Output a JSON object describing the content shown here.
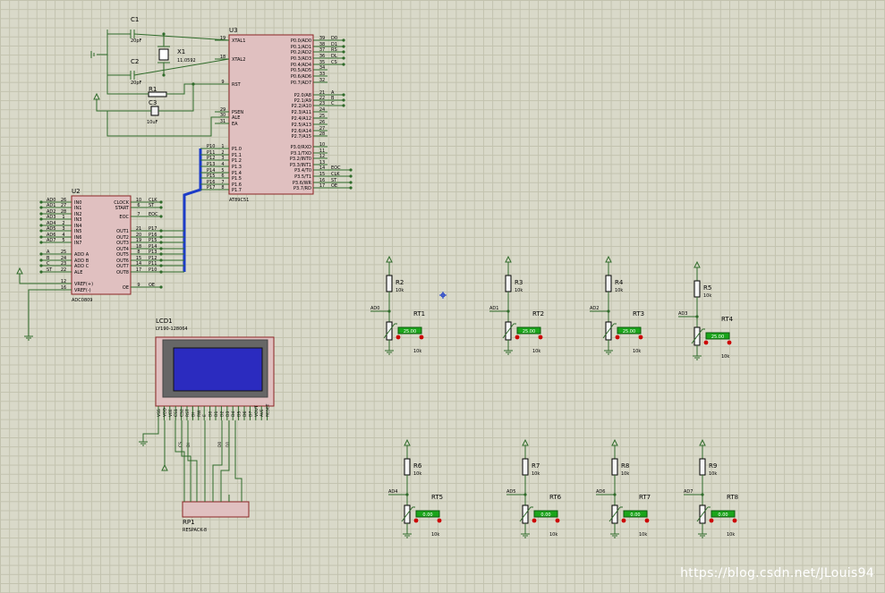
{
  "components": {
    "c1": {
      "ref": "C1",
      "value": "20pF"
    },
    "c2": {
      "ref": "C2",
      "value": "20pF"
    },
    "c3": {
      "ref": "C3",
      "value": "10uF"
    },
    "r1": {
      "ref": "R1"
    },
    "x1": {
      "ref": "X1",
      "value": "11.0592"
    },
    "u3": {
      "ref": "U3",
      "part": "AT89C51",
      "left_pins": [
        {
          "num": "19",
          "name": "XTAL1"
        },
        {
          "num": "18",
          "name": "XTAL2"
        },
        {
          "num": "9",
          "name": "RST"
        },
        {
          "num": "29",
          "name": "PSEN"
        },
        {
          "num": "30",
          "name": "ALE"
        },
        {
          "num": "31",
          "name": "EA"
        },
        {
          "num": "1",
          "name": "P1.0"
        },
        {
          "num": "2",
          "name": "P1.1"
        },
        {
          "num": "3",
          "name": "P1.2"
        },
        {
          "num": "4",
          "name": "P1.3"
        },
        {
          "num": "5",
          "name": "P1.4"
        },
        {
          "num": "6",
          "name": "P1.5"
        },
        {
          "num": "7",
          "name": "P1.6"
        },
        {
          "num": "8",
          "name": "P1.7"
        }
      ],
      "right_pins": [
        {
          "num": "39",
          "name": "P0.0/AD0"
        },
        {
          "num": "38",
          "name": "P0.1/AD1"
        },
        {
          "num": "37",
          "name": "P0.2/AD2"
        },
        {
          "num": "36",
          "name": "P0.3/AD3"
        },
        {
          "num": "35",
          "name": "P0.4/AD4"
        },
        {
          "num": "34",
          "name": "P0.5/AD5"
        },
        {
          "num": "33",
          "name": "P0.6/AD6"
        },
        {
          "num": "32",
          "name": "P0.7/AD7"
        },
        {
          "num": "21",
          "name": "P2.0/A8"
        },
        {
          "num": "22",
          "name": "P2.1/A9"
        },
        {
          "num": "23",
          "name": "P2.2/A10"
        },
        {
          "num": "24",
          "name": "P2.3/A11"
        },
        {
          "num": "25",
          "name": "P2.4/A12"
        },
        {
          "num": "26",
          "name": "P2.5/A13"
        },
        {
          "num": "27",
          "name": "P2.6/A14"
        },
        {
          "num": "28",
          "name": "P2.7/A15"
        },
        {
          "num": "10",
          "name": "P3.0/RXD"
        },
        {
          "num": "11",
          "name": "P3.1/TXD"
        },
        {
          "num": "12",
          "name": "P3.2/INT0"
        },
        {
          "num": "13",
          "name": "P3.3/INT1"
        },
        {
          "num": "14",
          "name": "P3.4/T0"
        },
        {
          "num": "15",
          "name": "P3.5/T1"
        },
        {
          "num": "16",
          "name": "P3.6/WR"
        },
        {
          "num": "17",
          "name": "P3.7/RD"
        }
      ],
      "p1_labels": [
        "P10",
        "P11",
        "P12",
        "P13",
        "P14",
        "P15",
        "P16",
        "P17"
      ],
      "p0_labels": [
        "D0",
        "D1",
        "RS",
        "DL",
        "CS"
      ],
      "p2_labels": [
        "A",
        "B",
        "C"
      ],
      "p3_labels": [
        "EOC",
        "CLK",
        "ST",
        "OE"
      ]
    },
    "u2": {
      "ref": "U2",
      "part": "ADC0809",
      "left_pins": [
        {
          "num": "26",
          "name": "IN0",
          "net": "AD0"
        },
        {
          "num": "27",
          "name": "IN1",
          "net": "AD1"
        },
        {
          "num": "28",
          "name": "IN2",
          "net": "AD2"
        },
        {
          "num": "1",
          "name": "IN3",
          "net": "AD3"
        },
        {
          "num": "2",
          "name": "IN4",
          "net": "AD4"
        },
        {
          "num": "3",
          "name": "IN5",
          "net": "AD5"
        },
        {
          "num": "4",
          "name": "IN6",
          "net": "AD6"
        },
        {
          "num": "5",
          "name": "IN7",
          "net": "AD7"
        },
        {
          "num": "25",
          "name": "ADD A",
          "net": "A"
        },
        {
          "num": "24",
          "name": "ADD B",
          "net": "B"
        },
        {
          "num": "23",
          "name": "ADD C",
          "net": "C"
        },
        {
          "num": "22",
          "name": "ALE",
          "net": "ST"
        },
        {
          "num": "12",
          "name": "VREF(+)",
          "net": ""
        },
        {
          "num": "16",
          "name": "VREF(-)",
          "net": ""
        }
      ],
      "right_pins": [
        {
          "num": "10",
          "name": "CLOCK",
          "net": "CLK"
        },
        {
          "num": "6",
          "name": "START",
          "net": "ST"
        },
        {
          "num": "7",
          "name": "EOC",
          "net": "EOC"
        },
        {
          "num": "21",
          "name": "OUT1",
          "net": "P17"
        },
        {
          "num": "20",
          "name": "OUT2",
          "net": "P16"
        },
        {
          "num": "19",
          "name": "OUT3",
          "net": "P15"
        },
        {
          "num": "18",
          "name": "OUT4",
          "net": "P14"
        },
        {
          "num": "8",
          "name": "OUT5",
          "net": "P13"
        },
        {
          "num": "15",
          "name": "OUT6",
          "net": "P12"
        },
        {
          "num": "14",
          "name": "OUT7",
          "net": "P11"
        },
        {
          "num": "17",
          "name": "OUT8",
          "net": "P10"
        },
        {
          "num": "9",
          "name": "OE",
          "net": "OE"
        }
      ]
    },
    "lcd": {
      "ref": "LCD1",
      "part": "LY190-128064",
      "pins": [
        "VSS",
        "VDD",
        "VEE",
        "CS1",
        "CS2",
        "RST",
        "DI",
        "RW",
        "E",
        "D0",
        "D1",
        "D2",
        "D3",
        "D4",
        "D5",
        "D6",
        "D7",
        "VOUT",
        "AVE",
        "RESET"
      ],
      "bottom_labels": [
        "CS",
        "DI",
        "D0",
        "D1"
      ]
    },
    "rp1": {
      "ref": "RP1",
      "part": "RESPACK-8"
    },
    "sensors": [
      {
        "res": "R2",
        "val": "10k",
        "ntc": "RT1",
        "ntc_val": "10k",
        "net": "AD0",
        "temp": "25.00"
      },
      {
        "res": "R3",
        "val": "10k",
        "ntc": "RT2",
        "ntc_val": "10k",
        "net": "AD1",
        "temp": "25.00"
      },
      {
        "res": "R4",
        "val": "10k",
        "ntc": "RT3",
        "ntc_val": "10k",
        "net": "AD2",
        "temp": "25.00"
      },
      {
        "res": "R5",
        "val": "10k",
        "ntc": "RT4",
        "ntc_val": "10k",
        "net": "AD3",
        "temp": "25.00"
      },
      {
        "res": "R6",
        "val": "10k",
        "ntc": "RT5",
        "ntc_val": "10k",
        "net": "AD4",
        "temp": "0.00"
      },
      {
        "res": "R7",
        "val": "10k",
        "ntc": "RT6",
        "ntc_val": "10k",
        "net": "AD5",
        "temp": "0.00"
      },
      {
        "res": "R8",
        "val": "10k",
        "ntc": "RT7",
        "ntc_val": "10k",
        "net": "AD6",
        "temp": "0.00"
      },
      {
        "res": "R9",
        "val": "10k",
        "ntc": "RT8",
        "ntc_val": "10k",
        "net": "AD7",
        "temp": "0.00"
      }
    ]
  },
  "colors": {
    "background": "#d9d9c9",
    "wire": "#2f6b2a",
    "bus": "#1c3cc8",
    "chip_fill": "#e0c0c0",
    "chip_stroke": "#8a2424",
    "lcd_screen": "#2b2bbf",
    "temp_box": "#1aa51a",
    "probe": "#cc0000"
  },
  "watermark": "https://blog.csdn.net/JLouis94"
}
